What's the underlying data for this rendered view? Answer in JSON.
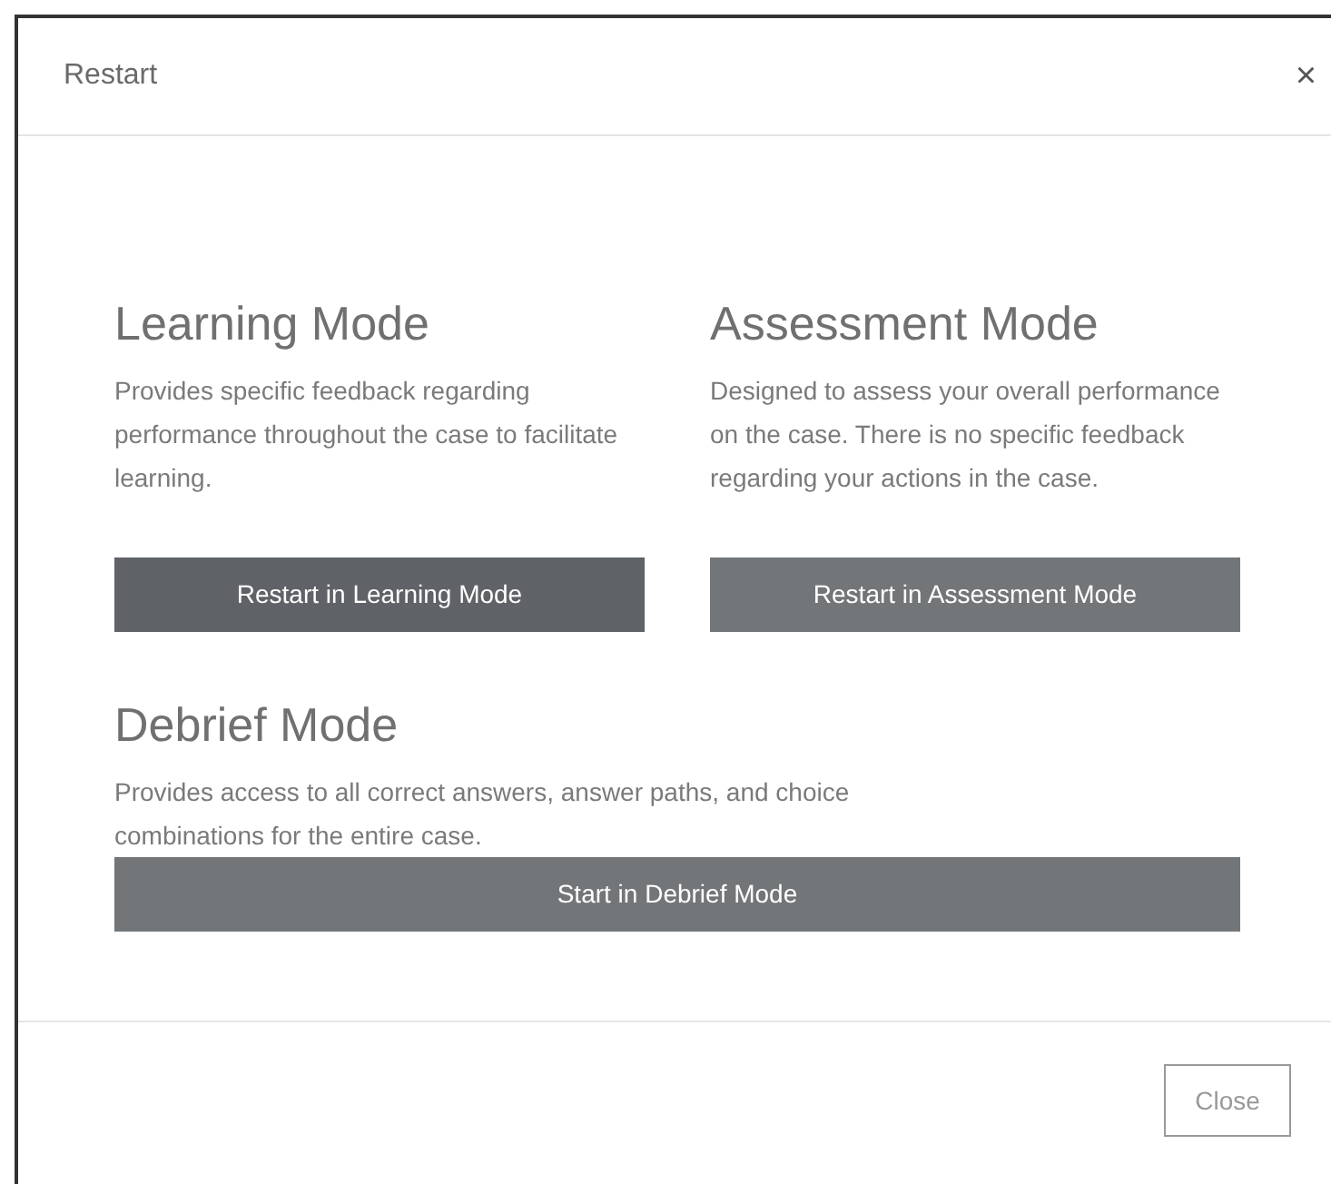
{
  "dialog": {
    "title": "Restart",
    "close_glyph": "×"
  },
  "modes": [
    {
      "heading": "Learning Mode",
      "description": "Provides specific feedback regarding performance throughout the case to facilitate learning.",
      "button": {
        "label": "Restart in Learning Mode",
        "hovered": true
      }
    },
    {
      "heading": "Assessment Mode",
      "description": "Designed to assess your overall performance on the case. There is no specific feedback regarding your actions in the case.",
      "button": {
        "label": "Restart in Assessment Mode",
        "hovered": false
      }
    },
    {
      "heading": "Debrief Mode",
      "description": "Provides access to all correct answers, answer paths, and choice combinations for the entire case.",
      "button": {
        "label": "Start in Debrief Mode",
        "hovered": false
      }
    }
  ],
  "footer": {
    "close_button": "Close"
  }
}
